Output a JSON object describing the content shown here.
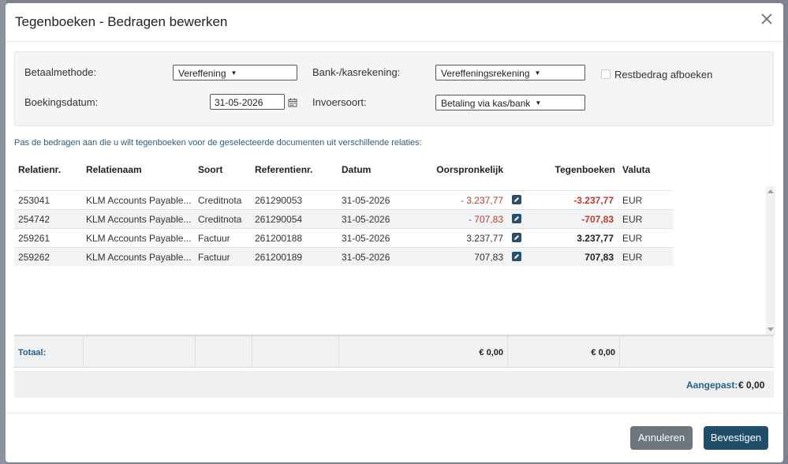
{
  "dialog": {
    "title": "Tegenboeken - Bedragen bewerken"
  },
  "form": {
    "payment_method_label": "Betaalmethode:",
    "payment_method_value": "Vereffening",
    "bank_account_label": "Bank-/kasrekening:",
    "bank_account_value": "Vereffeningsrekening",
    "write_off_label": "Restbedrag afboeken",
    "write_off_checked": false,
    "booking_date_label": "Boekingsdatum:",
    "booking_date_value": "31-05-2026",
    "entry_type_label": "Invoersoort:",
    "entry_type_value": "Betaling via kas/bank"
  },
  "instruction": "Pas de bedragen aan die u wilt tegenboeken voor de geselecteerde documenten uit verschillende relaties:",
  "table": {
    "headers": {
      "relation_no": "Relatienr.",
      "relation_name": "Relatienaam",
      "type": "Soort",
      "reference": "Referentienr.",
      "date": "Datum",
      "original": "Oorspronkelijk",
      "offset": "Tegenboeken",
      "currency": "Valuta"
    },
    "rows": [
      {
        "relation_no": "253041",
        "relation_name": "KLM Accounts Payable...",
        "type": "Creditnota",
        "reference": "261290053",
        "date": "31-05-2026",
        "original": "- 3.237,77",
        "offset": "-3.237,77",
        "currency": "EUR",
        "negative": true
      },
      {
        "relation_no": "254742",
        "relation_name": "KLM Accounts Payable...",
        "type": "Creditnota",
        "reference": "261290054",
        "date": "31-05-2026",
        "original": "- 707,83",
        "offset": "-707,83",
        "currency": "EUR",
        "negative": true
      },
      {
        "relation_no": "259261",
        "relation_name": "KLM Accounts Payable...",
        "type": "Factuur",
        "reference": "261200188",
        "date": "31-05-2026",
        "original": "3.237,77",
        "offset": "3.237,77",
        "currency": "EUR",
        "negative": false
      },
      {
        "relation_no": "259262",
        "relation_name": "KLM Accounts Payable...",
        "type": "Factuur",
        "reference": "261200189",
        "date": "31-05-2026",
        "original": "707,83",
        "offset": "707,83",
        "currency": "EUR",
        "negative": false
      }
    ]
  },
  "totals": {
    "label": "Totaal:",
    "original": "€ 0,00",
    "offset": "€ 0,00"
  },
  "adjusted": {
    "label": "Aangepast:",
    "value": "€ 0,00"
  },
  "buttons": {
    "cancel": "Annuleren",
    "confirm": "Bevestigen"
  },
  "colors": {
    "accent": "#1f4e6b",
    "link_text": "#2a5f85",
    "negative": "#c0392b",
    "cancel_button": "#6d757d",
    "edit_icon": "#2b4f6b"
  }
}
